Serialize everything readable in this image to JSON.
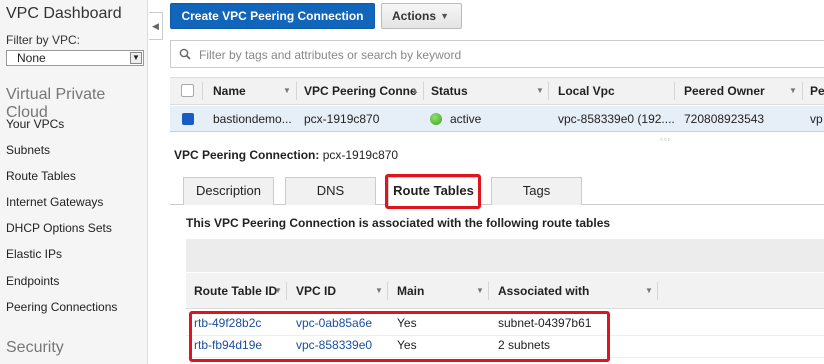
{
  "sidebar": {
    "title": "VPC Dashboard",
    "filter_label": "Filter by VPC:",
    "filter_value": "None",
    "section_vpc": "Virtual Private Cloud",
    "items": [
      "Your VPCs",
      "Subnets",
      "Route Tables",
      "Internet Gateways",
      "DHCP Options Sets",
      "Elastic IPs",
      "Endpoints",
      "Peering Connections"
    ],
    "section_security": "Security"
  },
  "toolbar": {
    "create_label": "Create VPC Peering Connection",
    "actions_label": "Actions"
  },
  "search": {
    "placeholder": "Filter by tags and attributes or search by keyword"
  },
  "grid": {
    "columns": [
      "Name",
      "VPC Peering Conne",
      "Status",
      "Local Vpc",
      "Peered Owner",
      "Pe"
    ],
    "row": {
      "name": "bastiondemo...",
      "peering_id": "pcx-1919c870",
      "status": "active",
      "local_vpc": "vpc-858339e0 (192....",
      "peered_owner": "720808923543",
      "pe": "vp"
    }
  },
  "detail": {
    "title_label": "VPC Peering Connection:",
    "title_value": "pcx-1919c870",
    "tabs": [
      "Description",
      "DNS",
      "Route Tables",
      "Tags"
    ],
    "active_tab": "Route Tables",
    "assoc_text": "This VPC Peering Connection is associated with the following route tables"
  },
  "route_tables": {
    "columns": [
      "Route Table ID",
      "VPC ID",
      "Main",
      "Associated with"
    ],
    "rows": [
      {
        "id": "rtb-49f28b2c",
        "vpc": "vpc-0ab85a6e",
        "main": "Yes",
        "assoc": "subnet-04397b61"
      },
      {
        "id": "rtb-fb94d19e",
        "vpc": "vpc-858339e0",
        "main": "Yes",
        "assoc": "2 subnets"
      }
    ]
  },
  "colors": {
    "primary": "#1166bb",
    "highlight": "#e0141e",
    "link": "#1a4fa0",
    "status_active": "#3aa51e"
  }
}
